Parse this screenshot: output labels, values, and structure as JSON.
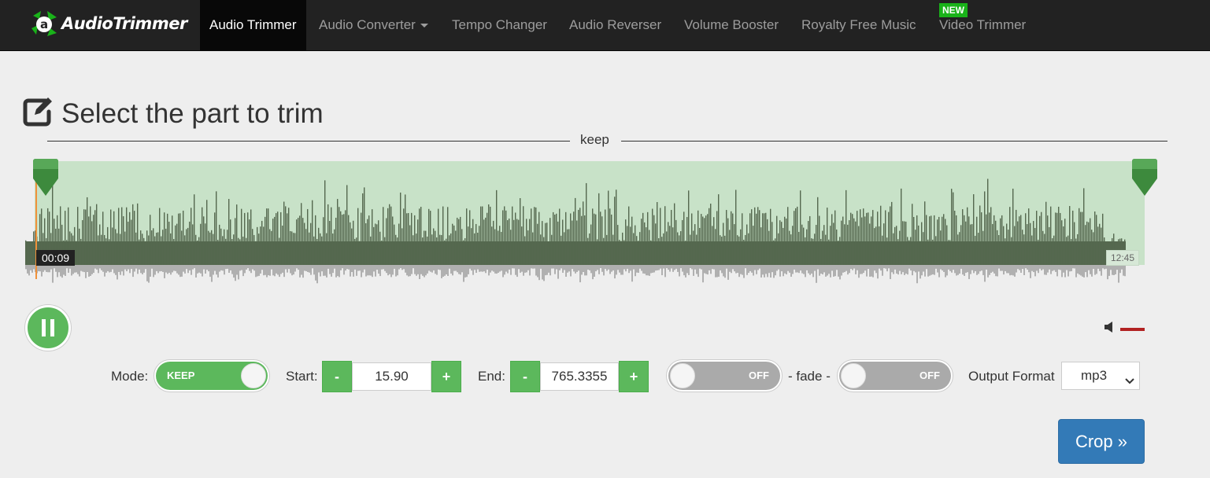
{
  "brand": {
    "name": "AudioTrimmer",
    "accent": "#19b219"
  },
  "nav": {
    "items": [
      {
        "label": "Audio Trimmer",
        "active": true
      },
      {
        "label": "Audio Converter",
        "dropdown": true
      },
      {
        "label": "Tempo Changer"
      },
      {
        "label": "Audio Reverser"
      },
      {
        "label": "Volume Booster"
      },
      {
        "label": "Royalty Free Music"
      },
      {
        "label": "Video Trimmer"
      }
    ],
    "new_badge": "NEW"
  },
  "main": {
    "title": "Select the part to trim",
    "region_label": "keep"
  },
  "player": {
    "current_time": "00:09",
    "duration": "12:45",
    "state": "playing",
    "volume_level": 1.0
  },
  "controls": {
    "mode_label": "Mode:",
    "mode_value": "KEEP",
    "start_label": "Start:",
    "start_value": "15.90",
    "end_label": "End:",
    "end_value": "765.3355",
    "minus": "-",
    "plus": "+",
    "fade_in": "OFF",
    "fade_label": "- fade -",
    "fade_out": "OFF",
    "output_label": "Output Format",
    "output_value": "mp3"
  },
  "actions": {
    "crop_label": "Crop »"
  },
  "colors": {
    "navbar": "#222222",
    "green": "#5cb85c",
    "region": "#c8e2c8",
    "wave": "#55684f",
    "primary": "#337ab7"
  }
}
